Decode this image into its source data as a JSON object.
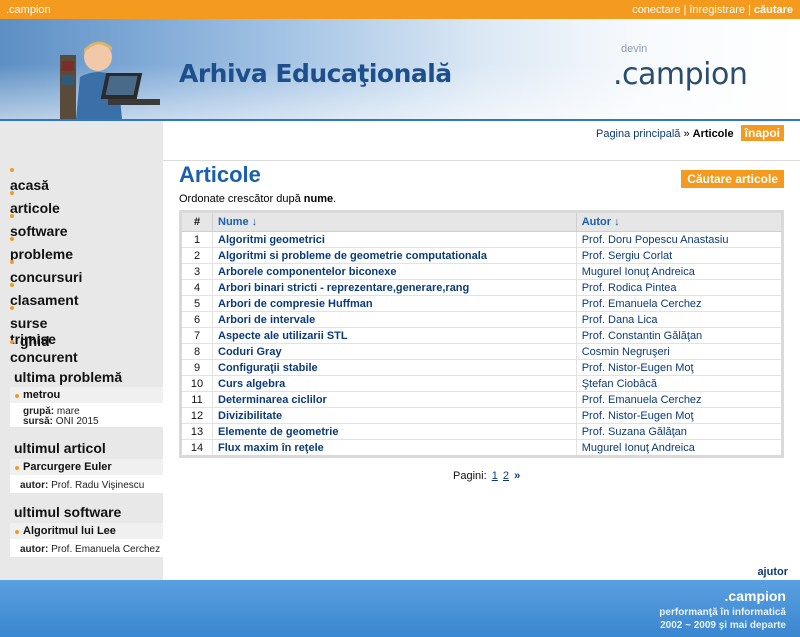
{
  "topbar": {
    "site": ".campion",
    "login": "conectare",
    "register": "înregistrare",
    "search": "căutare"
  },
  "banner": {
    "title": "Arhiva Educaţională",
    "logo_prefix": "devin",
    "logo": ".campion"
  },
  "breadcrumb": {
    "home": "Pagina principală",
    "separator": "»",
    "current": "Articole",
    "back": "înapoi"
  },
  "nav": {
    "items": [
      "acasă",
      "articole",
      "software",
      "probleme",
      "concursuri",
      "clasament",
      "surse trimise"
    ],
    "guide": "ghid concurent"
  },
  "sidebar": {
    "last_problem": {
      "heading": "ultima problemă",
      "name": "metrou",
      "group_label": "grupă:",
      "group": "mare",
      "source_label": "sursă:",
      "source": "ONI 2015"
    },
    "last_article": {
      "heading": "ultimul articol",
      "name": "Parcurgere Euler",
      "author_label": "autor:",
      "author": "Prof. Radu Vişinescu"
    },
    "last_software": {
      "heading": "ultimul software",
      "name": "Algoritmul lui Lee",
      "author_label": "autor:",
      "author": "Prof. Emanuela Cerchez"
    }
  },
  "main": {
    "title": "Articole",
    "search_button": "Căutare articole",
    "order_prefix": "Ordonate crescător după",
    "order_field": "nume",
    "order_suffix": "."
  },
  "table": {
    "headers": {
      "num": "#",
      "name": "Nume ↓",
      "author": "Autor ↓"
    },
    "rows": [
      {
        "n": "1",
        "title": "Algoritmi geometrici",
        "author": "Prof. Doru Popescu Anastasiu"
      },
      {
        "n": "2",
        "title": "Algoritmi si probleme de geometrie computationala",
        "author": "Prof. Sergiu Corlat"
      },
      {
        "n": "3",
        "title": "Arborele componentelor biconexe",
        "author": "Mugurel Ionuţ Andreica"
      },
      {
        "n": "4",
        "title": "Arbori binari stricti - reprezentare,generare,rang",
        "author": "Prof. Rodica Pintea"
      },
      {
        "n": "5",
        "title": "Arbori de compresie Huffman",
        "author": "Prof. Emanuela Cerchez"
      },
      {
        "n": "6",
        "title": "Arbori de intervale",
        "author": "Prof. Dana Lica"
      },
      {
        "n": "7",
        "title": "Aspecte ale utilizarii STL",
        "author": "Prof. Constantin Gălăţan"
      },
      {
        "n": "8",
        "title": "Coduri Gray",
        "author": "Cosmin Negruşeri"
      },
      {
        "n": "9",
        "title": "Configuraţii stabile",
        "author": "Prof. Nistor-Eugen Moţ"
      },
      {
        "n": "10",
        "title": "Curs algebra",
        "author": "Ştefan Ciobâcă"
      },
      {
        "n": "11",
        "title": "Determinarea ciclilor",
        "author": "Prof. Emanuela Cerchez"
      },
      {
        "n": "12",
        "title": "Divizibilitate",
        "author": "Prof. Nistor-Eugen Moţ"
      },
      {
        "n": "13",
        "title": "Elemente de geometrie",
        "author": "Prof. Suzana Gălăţan"
      },
      {
        "n": "14",
        "title": "Flux maxim în reţele",
        "author": "Mugurel Ionuţ Andreica"
      }
    ]
  },
  "pager": {
    "label": "Pagini:",
    "pages": [
      "1",
      "2"
    ],
    "next": "»"
  },
  "help": "ajutor",
  "footer": {
    "brand": ".campion",
    "tagline": "performanţă în informatică",
    "years": "2002 ~ 2009 şi mai departe"
  },
  "colors": {
    "accent": "#f39a1f",
    "link": "#0b3a7a",
    "title": "#1a5fb0"
  }
}
